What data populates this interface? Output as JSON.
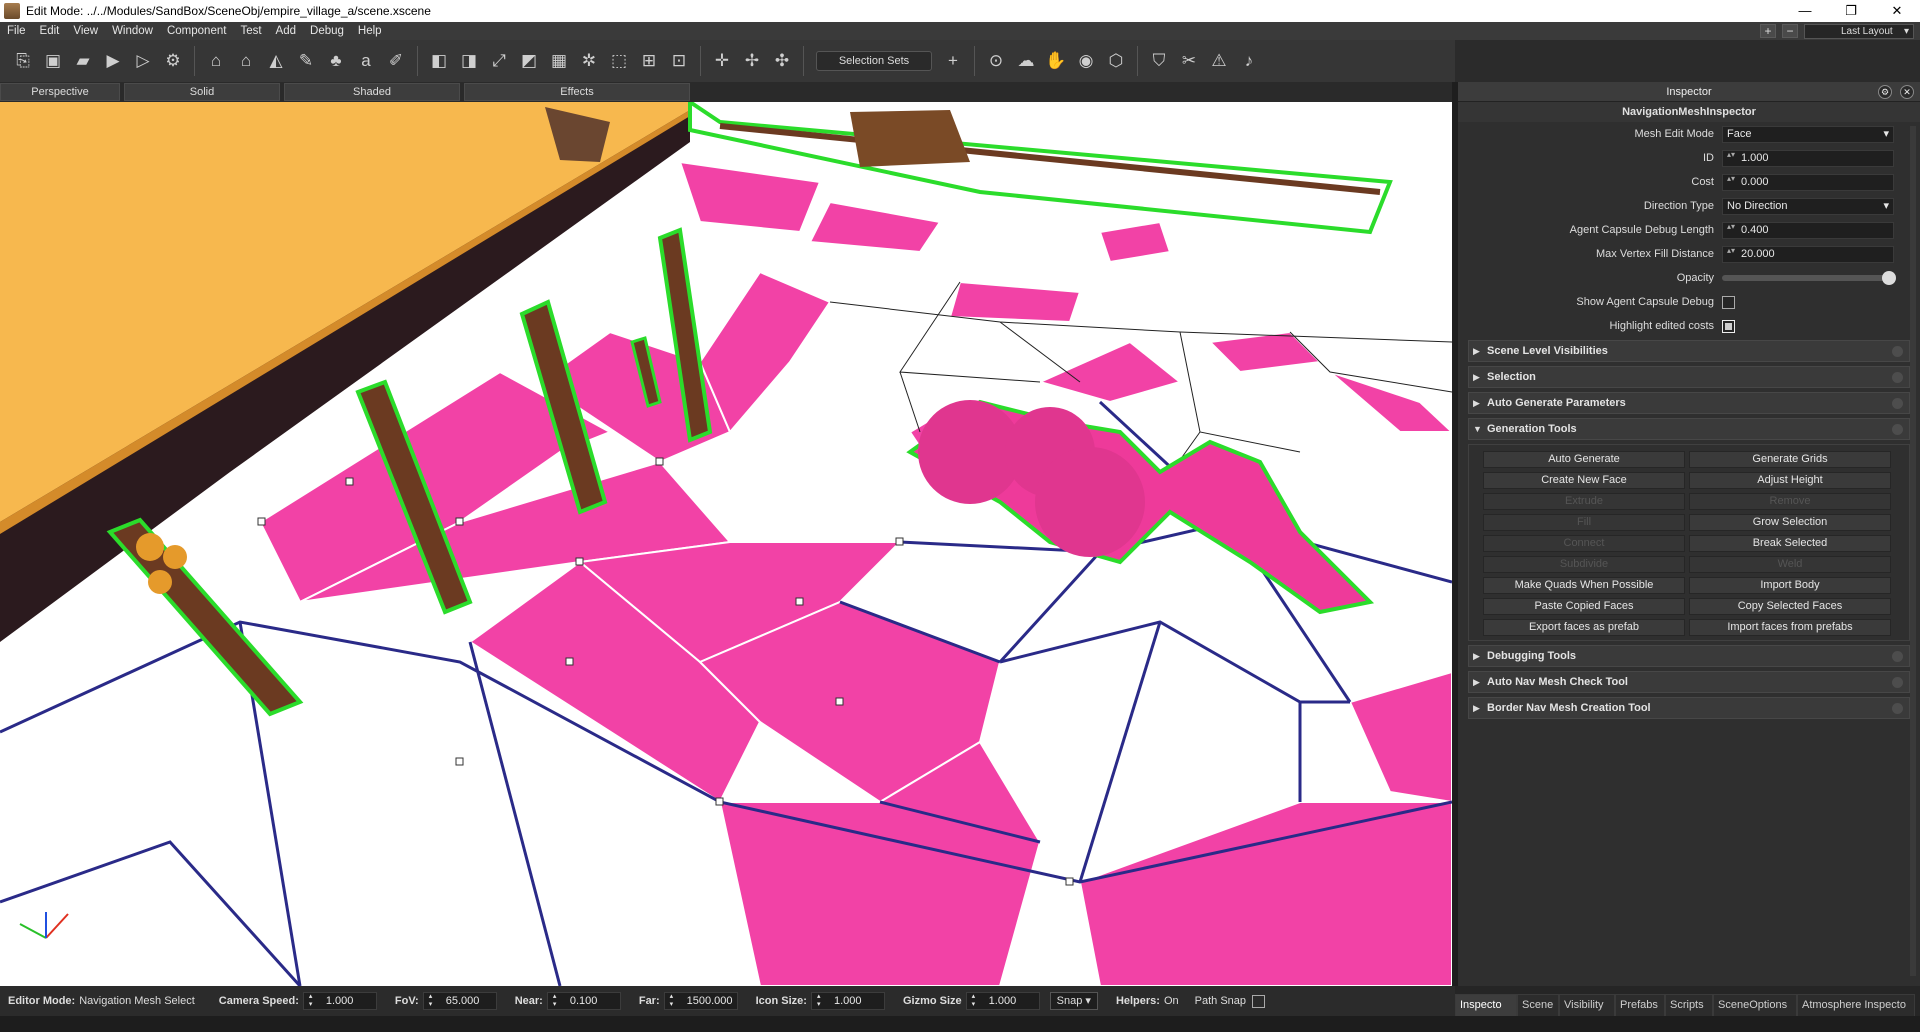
{
  "window": {
    "title": "Edit Mode: ../../Modules/SandBox/SceneObj/empire_village_a/scene.xscene",
    "controls": [
      "—",
      "❐",
      "✕"
    ]
  },
  "menu": {
    "items": [
      "File",
      "Edit",
      "View",
      "Window",
      "Component",
      "Test",
      "Add",
      "Debug",
      "Help"
    ],
    "plus": "+",
    "minus": "−",
    "layout": "Last Layout"
  },
  "toolbar": {
    "selection_sets": "Selection Sets",
    "add": "+"
  },
  "view_tabs": [
    "Perspective",
    "Solid",
    "Shaded",
    "Effects"
  ],
  "inspector": {
    "title": "Inspector",
    "subtitle": "NavigationMeshInspector",
    "props": {
      "mesh_edit_mode": {
        "label": "Mesh Edit Mode",
        "value": "Face"
      },
      "id": {
        "label": "ID",
        "value": "1.000"
      },
      "cost": {
        "label": "Cost",
        "value": "0.000"
      },
      "direction_type": {
        "label": "Direction Type",
        "value": "No Direction"
      },
      "agent_capsule_len": {
        "label": "Agent Capsule Debug Length",
        "value": "0.400"
      },
      "max_vertex_fill": {
        "label": "Max Vertex Fill Distance",
        "value": "20.000"
      },
      "opacity": {
        "label": "Opacity",
        "value": 1.0
      },
      "show_agent_capsule": {
        "label": "Show Agent Capsule Debug",
        "checked": false
      },
      "highlight_costs": {
        "label": "Highlight edited costs",
        "checked": true
      }
    },
    "sections": {
      "scene_level": "Scene Level Visibilities",
      "selection": "Selection",
      "auto_gen_params": "Auto Generate Parameters",
      "generation_tools": "Generation Tools",
      "debugging_tools": "Debugging Tools",
      "auto_nav_check": "Auto Nav Mesh Check Tool",
      "border_nav": "Border Nav Mesh Creation Tool"
    },
    "gen_buttons": {
      "auto_generate": "Auto Generate",
      "generate_grids": "Generate Grids",
      "create_new_face": "Create New Face",
      "adjust_height": "Adjust Height",
      "extrude": "Extrude",
      "remove": "Remove",
      "fill": "Fill",
      "grow_selection": "Grow Selection",
      "connect": "Connect",
      "break_selected": "Break Selected",
      "subdivide": "Subdivide",
      "weld": "Weld",
      "make_quads": "Make Quads When Possible",
      "import_body": "Import Body",
      "paste_faces": "Paste Copied Faces",
      "copy_faces": "Copy Selected Faces",
      "export_prefab": "Export faces as prefab",
      "import_prefab": "Import faces from prefabs"
    }
  },
  "status": {
    "editor_mode_label": "Editor Mode:",
    "editor_mode_value": "Navigation Mesh Select",
    "camera_speed_label": "Camera Speed:",
    "camera_speed": "1.000",
    "fov_label": "FoV:",
    "fov": "65.000",
    "near_label": "Near:",
    "near": "0.100",
    "far_label": "Far:",
    "far": "1500.000",
    "icon_size_label": "Icon Size:",
    "icon_size": "1.000",
    "gizmo_size_label": "Gizmo Size",
    "gizmo_size": "1.000",
    "snap": "Snap ▾",
    "helpers_label": "Helpers:",
    "helpers_value": "On",
    "path_snap": "Path Snap"
  },
  "bottom_tabs": [
    "Inspecto",
    "Scene",
    "Visibility",
    "Prefabs",
    "Scripts",
    "SceneOptions",
    "Atmosphere Inspecto"
  ],
  "colors": {
    "navmesh_pink": "#f245a8",
    "selection_green": "#2bdc2b",
    "wall_yellow": "#f7b84e",
    "wall_dark": "#2b1a1e",
    "edge_blue": "#2a2a88"
  }
}
